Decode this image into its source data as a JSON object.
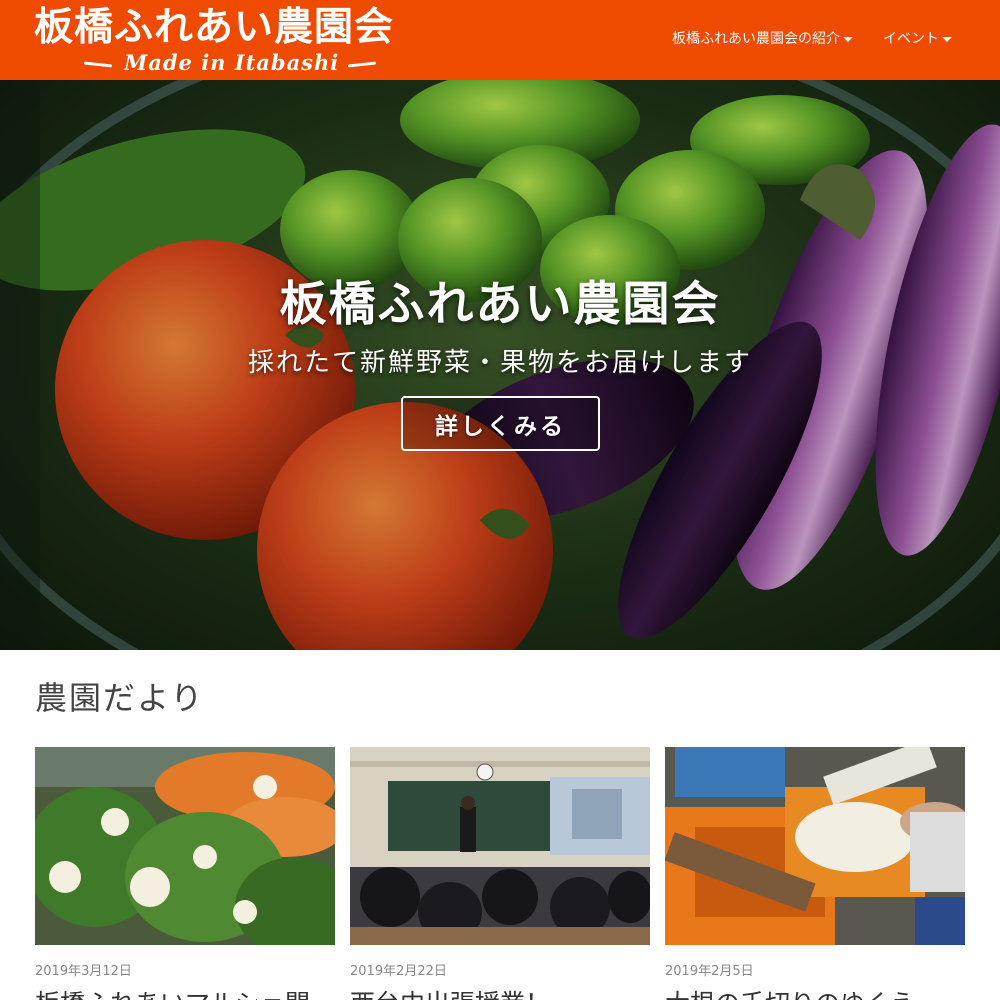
{
  "header": {
    "logo_title": "板橋ふれあい農園会",
    "logo_subtitle": "Made in Itabashi",
    "background": "#ef4b00",
    "nav": [
      {
        "label": "板橋ふれあい農園会の紹介",
        "icon": "caret-down-icon"
      },
      {
        "label": "イベント",
        "icon": "caret-down-icon"
      }
    ]
  },
  "hero": {
    "title": "板橋ふれあい農園会",
    "subtitle": "採れたて新鮮野菜・果物をお届けします",
    "button_label": "詳しくみる"
  },
  "news": {
    "section_title": "農園だより",
    "cards": [
      {
        "date": "2019年3月12日",
        "title": "板橋ふれあいマルシェ開"
      },
      {
        "date": "2019年2月22日",
        "title": "西台中出張授業！"
      },
      {
        "date": "2019年2月5日",
        "title": "大根の千切りのゆくえ"
      }
    ]
  }
}
